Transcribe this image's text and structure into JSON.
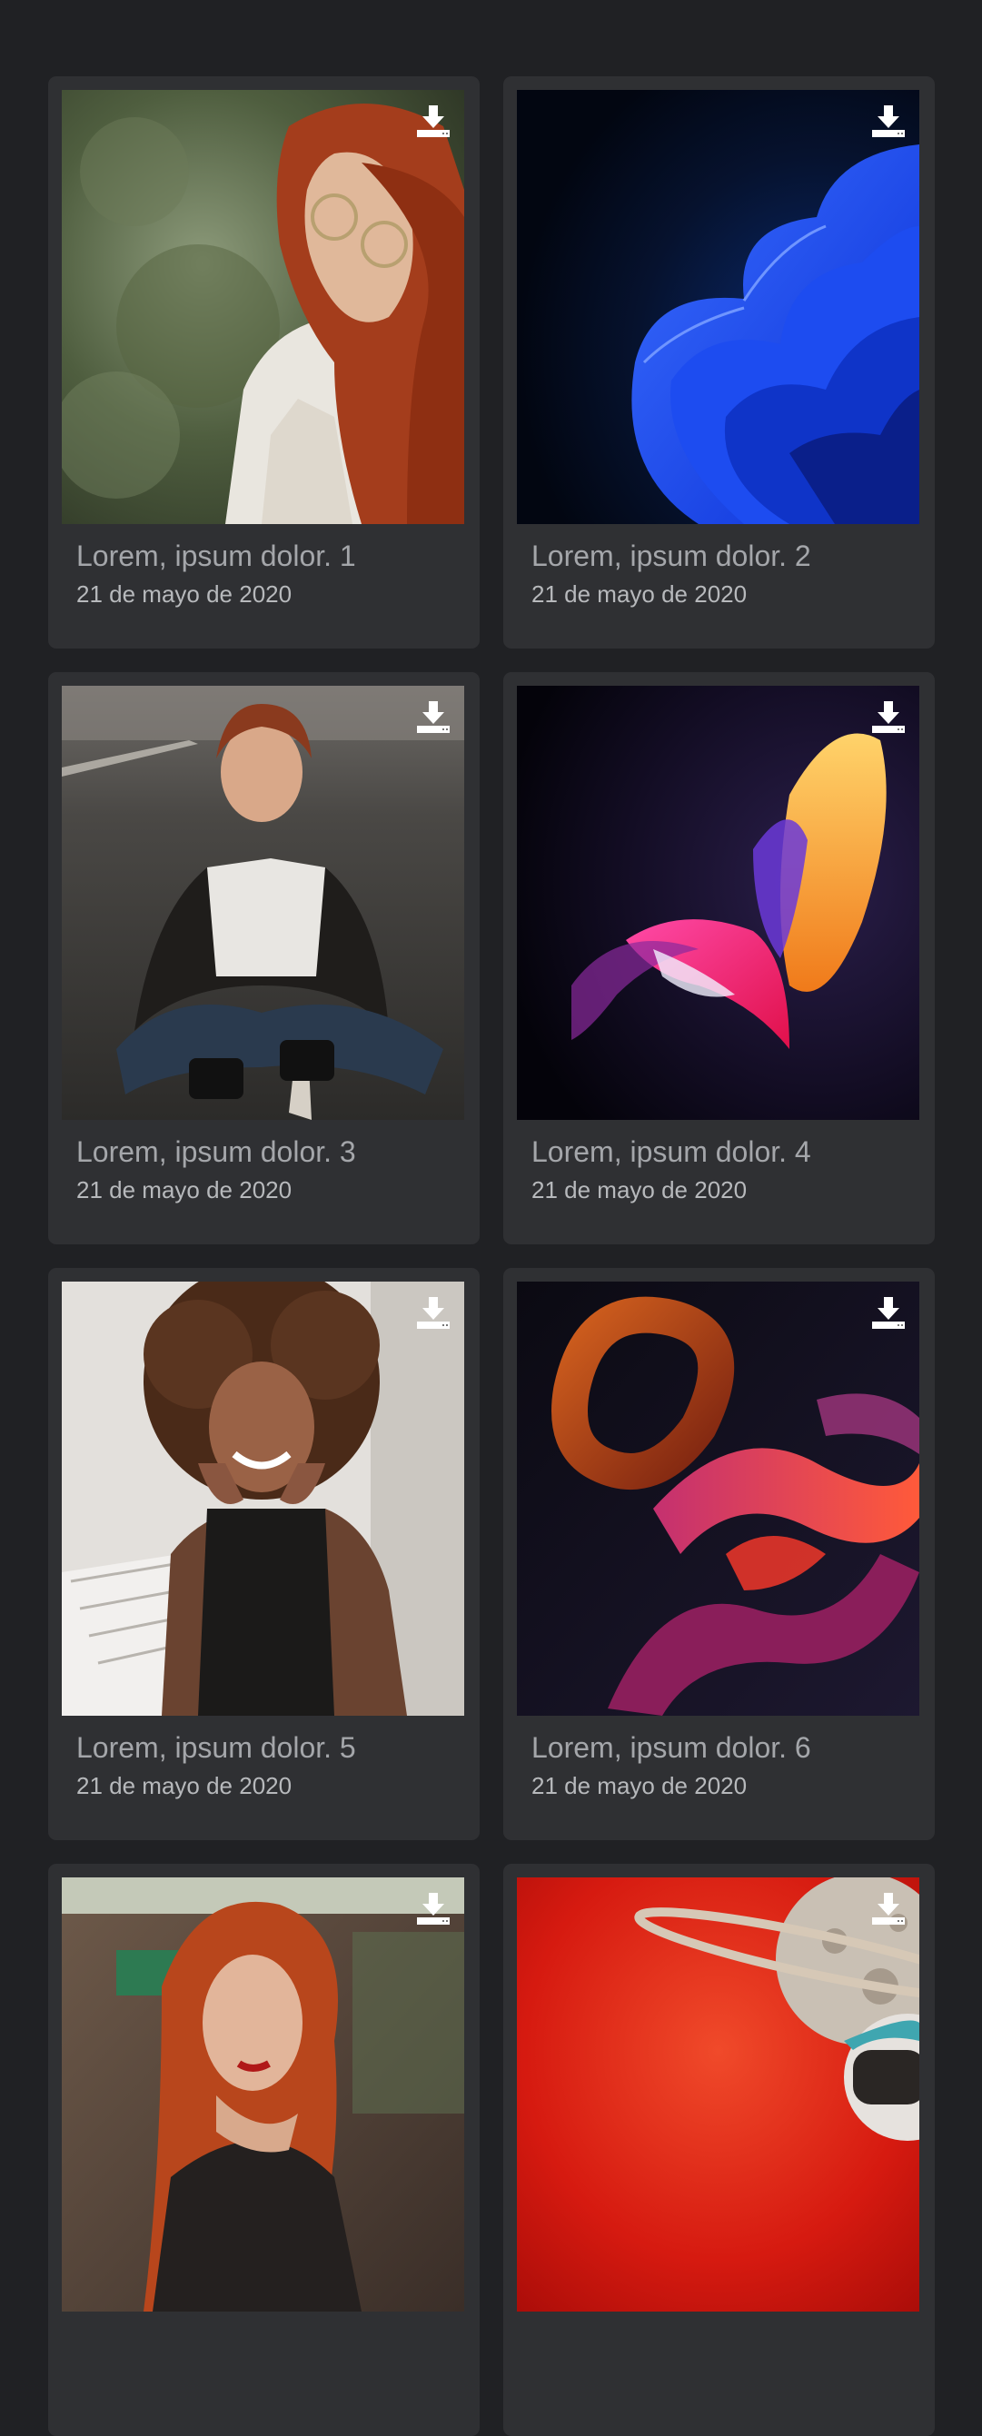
{
  "gallery": {
    "items": [
      {
        "title": "Lorem, ipsum dolor. 1",
        "date": "21 de mayo de 2020",
        "image": "woman-red-hair-glasses-photo",
        "download_icon": "download-icon"
      },
      {
        "title": "Lorem, ipsum dolor. 2",
        "date": "21 de mayo de 2020",
        "image": "blue-abstract-bloom-wallpaper",
        "download_icon": "download-icon"
      },
      {
        "title": "Lorem, ipsum dolor. 3",
        "date": "21 de mayo de 2020",
        "image": "woman-sitting-on-road-photo",
        "download_icon": "download-icon"
      },
      {
        "title": "Lorem, ipsum dolor. 4",
        "date": "21 de mayo de 2020",
        "image": "pink-orange-abstract-wallpaper",
        "download_icon": "download-icon"
      },
      {
        "title": "Lorem, ipsum dolor. 5",
        "date": "21 de mayo de 2020",
        "image": "smiling-woman-curly-hair-photo",
        "download_icon": "download-icon"
      },
      {
        "title": "Lorem, ipsum dolor. 6",
        "date": "21 de mayo de 2020",
        "image": "ribbon-abstract-wallpaper",
        "download_icon": "download-icon"
      },
      {
        "title": "",
        "date": "",
        "image": "redhead-woman-portrait-photo",
        "download_icon": "download-icon"
      },
      {
        "title": "",
        "date": "",
        "image": "red-planet-astronaut-art",
        "download_icon": "download-icon"
      }
    ]
  },
  "colors": {
    "background": "#202124",
    "card": "#2f3033",
    "title": "#a4a6aa",
    "date": "#b7b9bc"
  }
}
